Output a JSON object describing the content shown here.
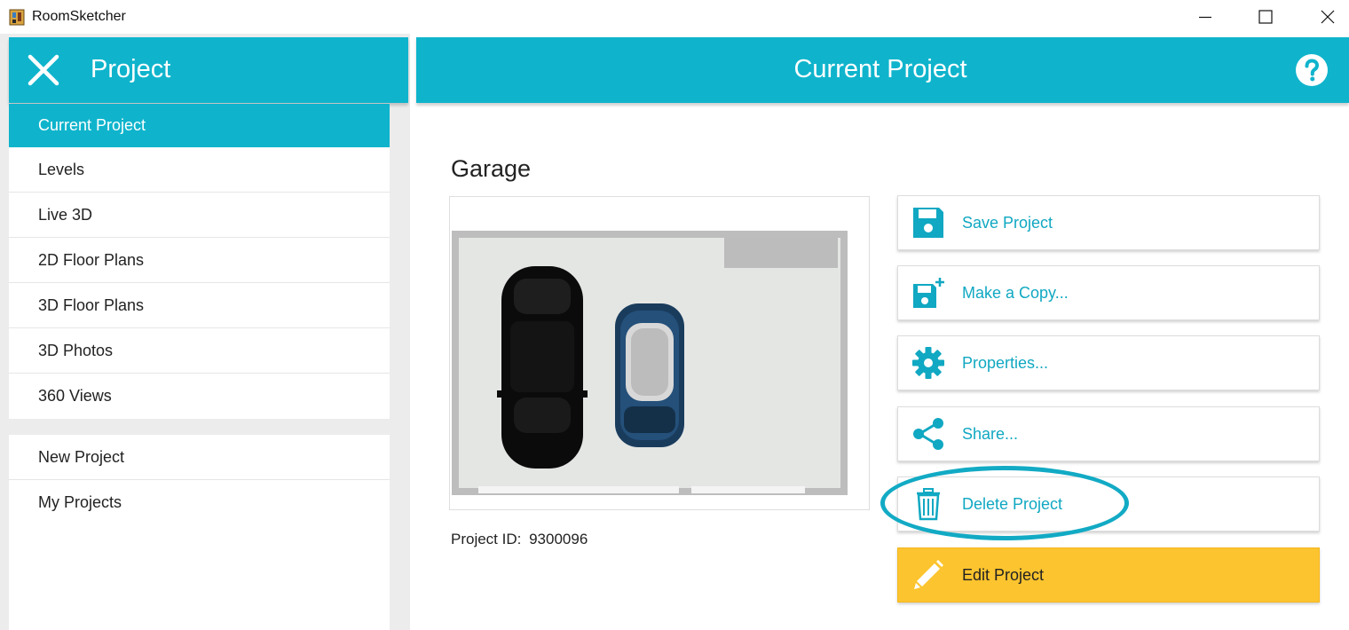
{
  "window": {
    "title": "RoomSketcher",
    "app_icon": "roomsketcher-app-icon",
    "controls": [
      "minimize-icon",
      "maximize-icon",
      "close-icon"
    ]
  },
  "sidebar": {
    "title": "Project",
    "close_icon": "close-x-icon",
    "items": [
      {
        "label": "Current Project",
        "active": true
      },
      {
        "label": "Levels"
      },
      {
        "label": "Live 3D"
      },
      {
        "label": "2D Floor Plans"
      },
      {
        "label": "3D Floor Plans"
      },
      {
        "label": "3D Photos"
      },
      {
        "label": "360 Views"
      }
    ],
    "secondary_items": [
      {
        "label": "New Project"
      },
      {
        "label": "My Projects"
      }
    ]
  },
  "main": {
    "title": "Current Project",
    "help_icon": "help-question-icon",
    "project": {
      "name": "Garage",
      "id_label": "Project ID:",
      "id": "9300096"
    },
    "actions": [
      {
        "label": "Save Project",
        "icon": "save-disk-icon"
      },
      {
        "label": "Make a Copy...",
        "icon": "copy-disk-plus-icon"
      },
      {
        "label": "Properties...",
        "icon": "gear-icon"
      },
      {
        "label": "Share...",
        "icon": "share-icon"
      },
      {
        "label": "Delete Project",
        "icon": "trash-icon",
        "highlighted": true
      },
      {
        "label": "Edit Project",
        "icon": "pencil-icon",
        "primary": true
      }
    ]
  },
  "colors": {
    "accent": "#0fb4cc",
    "action_text": "#10a8c2",
    "edit_button": "#fcc42e",
    "highlight_ring": "#12aac4",
    "sidebar_bg": "#ececec"
  }
}
